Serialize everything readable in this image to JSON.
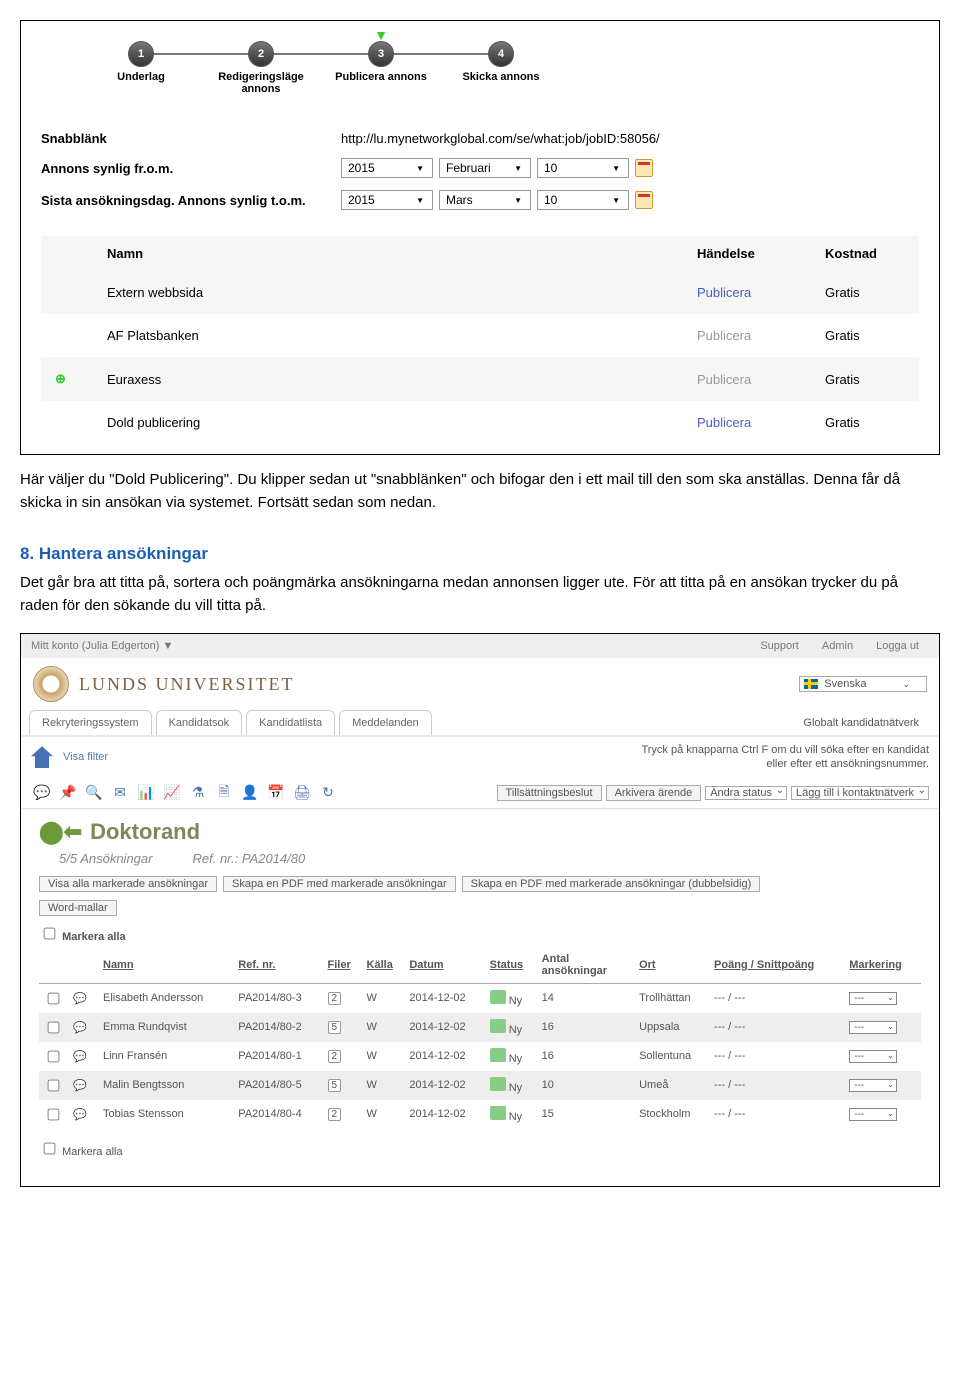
{
  "steps": [
    {
      "num": "1",
      "label": "Underlag"
    },
    {
      "num": "2",
      "label": "Redigeringsläge annons"
    },
    {
      "num": "3",
      "label": "Publicera annons",
      "active": "▾"
    },
    {
      "num": "4",
      "label": "Skicka annons"
    }
  ],
  "form": {
    "snabblank_label": "Snabblänk",
    "snabblank_value": "http://lu.mynetworkglobal.com/se/what:job/jobID:58056/",
    "from_label": "Annons synlig fr.o.m.",
    "from_year": "2015",
    "from_month": "Februari",
    "from_day": "10",
    "to_label": "Sista ansökningsdag. Annons synlig t.o.m.",
    "to_year": "2015",
    "to_month": "Mars",
    "to_day": "10"
  },
  "channels": {
    "headers": {
      "name": "Namn",
      "event": "Händelse",
      "cost": "Kostnad"
    },
    "rows": [
      {
        "name": "Extern webbsida",
        "event": "Publicera",
        "cost": "Gratis",
        "alt": false,
        "gray": false,
        "plus": false
      },
      {
        "name": "AF Platsbanken",
        "event": "Publicera",
        "cost": "Gratis",
        "alt": true,
        "gray": true,
        "plus": false
      },
      {
        "name": "Euraxess",
        "event": "Publicera",
        "cost": "Gratis",
        "alt": false,
        "gray": true,
        "plus": true
      },
      {
        "name": "Dold publicering",
        "event": "Publicera",
        "cost": "Gratis",
        "alt": true,
        "gray": false,
        "plus": false
      }
    ]
  },
  "body": {
    "p1": "Här väljer du \"Dold Publicering\". Du klipper sedan ut \"snabblänken\" och bifogar den i ett mail till den som ska anställas. Denna får då skicka in sin ansökan via systemet. Fortsätt sedan som nedan.",
    "h": "8. Hantera ansökningar",
    "p2": "Det går bra att titta på, sortera och poängmärka ansökningarna medan annonsen ligger ute. För att titta på en ansökan trycker du på raden för den sökande du vill titta på."
  },
  "rec": {
    "account": "Mitt konto (Julia Edgerton) ▼",
    "links": {
      "support": "Support",
      "admin": "Admin",
      "logout": "Logga ut"
    },
    "brand": "LUNDS UNIVERSITET",
    "lang": "Svenska",
    "tabs": [
      "Rekryteringssystem",
      "Kandidatsok",
      "Kandidatlista",
      "Meddelanden"
    ],
    "tabright": "Globalt kandidatnätverk",
    "visafilter": "Visa filter",
    "help": "Tryck på knapparna Ctrl F om du vill söka efter en kandidat eller efter ett ansökningsnummer.",
    "toolbtns": {
      "till": "Tillsättningsbeslut",
      "ark": "Arkivera ärende"
    },
    "selects": {
      "status": "Ändra status",
      "kontakt": "Lägg till i kontaktnätverk"
    },
    "jobtitle": "Doktorand",
    "count": "5/5 Ansökningar",
    "ref": "Ref. nr.: PA2014/80",
    "btns": [
      "Visa alla markerade ansökningar",
      "Skapa en PDF med markerade ansökningar",
      "Skapa en PDF med markerade ansökningar (dubbelsidig)",
      "Word-mallar"
    ],
    "markall": "Markera alla",
    "cols": {
      "name": "Namn",
      "ref": "Ref. nr.",
      "filer": "Filer",
      "kalla": "Källa",
      "datum": "Datum",
      "status": "Status",
      "antal": "Antal ansökningar",
      "ort": "Ort",
      "poang": "Poäng / Snittpoäng",
      "mark": "Markering"
    },
    "rows": [
      {
        "name": "Elisabeth Andersson",
        "ref": "PA2014/80-3",
        "filer": "2",
        "kalla": "W",
        "datum": "2014-12-02",
        "status": "Ny",
        "antal": "14",
        "ort": "Trollhättan",
        "p": "--- / ---",
        "m": "---",
        "alt": false
      },
      {
        "name": "Emma Rundqvist",
        "ref": "PA2014/80-2",
        "filer": "5",
        "kalla": "W",
        "datum": "2014-12-02",
        "status": "Ny",
        "antal": "16",
        "ort": "Uppsala",
        "p": "--- / ---",
        "m": "---",
        "alt": true
      },
      {
        "name": "Linn Fransén",
        "ref": "PA2014/80-1",
        "filer": "2",
        "kalla": "W",
        "datum": "2014-12-02",
        "status": "Ny",
        "antal": "16",
        "ort": "Sollentuna",
        "p": "--- / ---",
        "m": "---",
        "alt": false
      },
      {
        "name": "Malin Bengtsson",
        "ref": "PA2014/80-5",
        "filer": "5",
        "kalla": "W",
        "datum": "2014-12-02",
        "status": "Ny",
        "antal": "10",
        "ort": "Umeå",
        "p": "--- / ---",
        "m": "---",
        "alt": true
      },
      {
        "name": "Tobias Stensson",
        "ref": "PA2014/80-4",
        "filer": "2",
        "kalla": "W",
        "datum": "2014-12-02",
        "status": "Ny",
        "antal": "15",
        "ort": "Stockholm",
        "p": "--- / ---",
        "m": "---",
        "alt": false
      }
    ],
    "markall2": "Markera alla"
  }
}
